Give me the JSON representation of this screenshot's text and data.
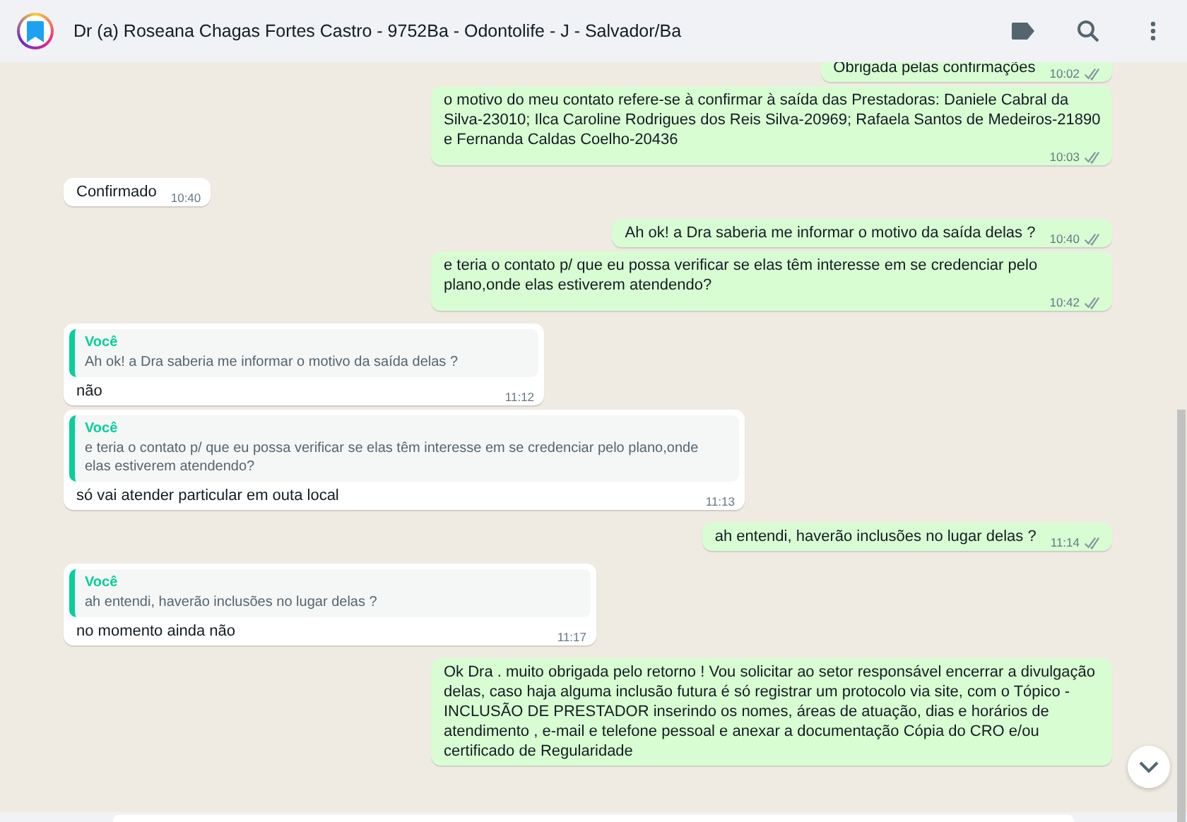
{
  "header": {
    "title": "Dr (a) Roseana Chagas Fortes Castro - 9752Ba - Odontolife - J - Salvador/Ba"
  },
  "messages": [
    {
      "kind": "outgoing",
      "text": "Obrigada pelas confirmações",
      "time": "10:02"
    },
    {
      "kind": "outgoing",
      "text": "o motivo do meu contato refere-se à confirmar à saída das Prestadoras: Daniele Cabral da Silva-23010; Ilca Caroline Rodrigues dos Reis Silva-20969; Rafaela Santos de Medeiros-21890 e Fernanda Caldas Coelho-20436",
      "time": "10:03"
    },
    {
      "kind": "incoming",
      "text": "Confirmado",
      "time": "10:40"
    },
    {
      "kind": "outgoing",
      "text": "Ah ok! a Dra saberia me informar o motivo da saída delas ?",
      "time": "10:40"
    },
    {
      "kind": "outgoing",
      "text": "e teria o contato p/ que eu possa verificar se elas têm interesse em se credenciar pelo plano,onde elas estiverem atendendo?",
      "time": "10:42"
    },
    {
      "kind": "incoming",
      "quote": {
        "author": "Você",
        "text": "Ah ok! a Dra saberia me informar o motivo da saída delas ?"
      },
      "text": "não",
      "time": "11:12"
    },
    {
      "kind": "incoming",
      "quote": {
        "author": "Você",
        "text": "e teria o contato p/ que eu possa verificar se elas têm interesse em se credenciar pelo plano,onde elas estiverem atendendo?"
      },
      "text": "só vai atender particular em outa local",
      "time": "11:13"
    },
    {
      "kind": "outgoing",
      "text": "ah entendi, haverão inclusões no lugar delas ?",
      "time": "11:14"
    },
    {
      "kind": "incoming",
      "quote": {
        "author": "Você",
        "text": "ah entendi, haverão inclusões no lugar delas ?"
      },
      "text": "no momento ainda não",
      "time": "11:17"
    },
    {
      "kind": "outgoing",
      "text": "Ok Dra . muito obrigada pelo retorno ! Vou solicitar ao setor responsável encerrar a divulgação delas, caso haja alguma inclusão futura é só registrar um protocolo via site, com o Tópico - INCLUSÃO DE PRESTADOR inserindo os nomes, áreas de atuação, dias e horários de atendimento , e-mail e telefone pessoal e anexar a documentação Cópia do CRO e/ou certificado de Regularidade"
    }
  ]
}
